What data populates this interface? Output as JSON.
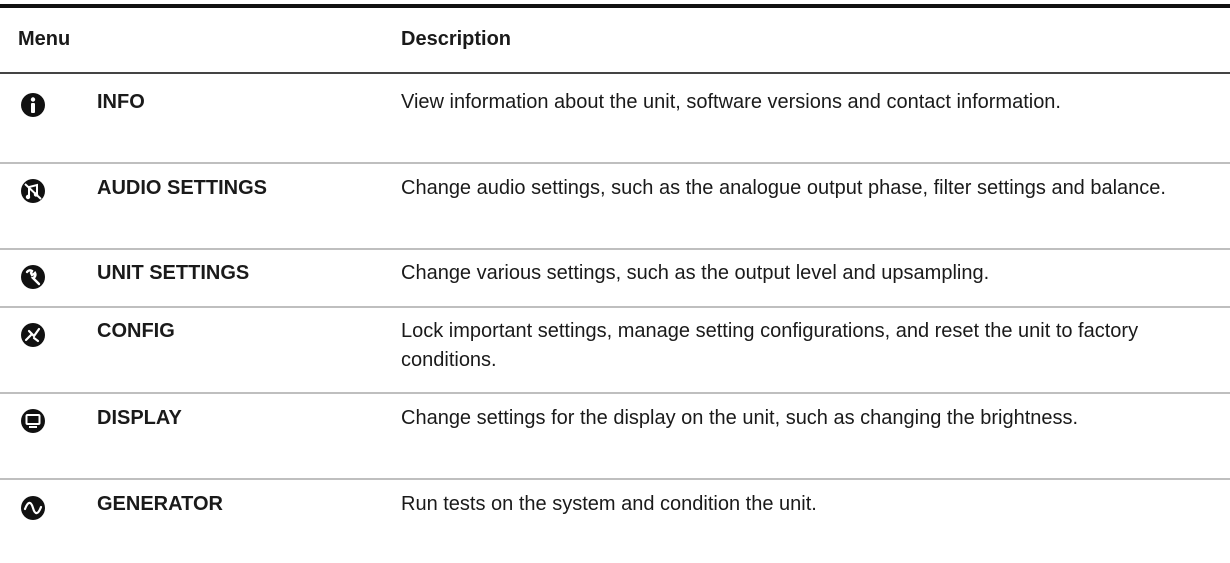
{
  "table": {
    "header": {
      "menu": "Menu",
      "description": "Description"
    },
    "rows": [
      {
        "icon": "info-icon",
        "name": "INFO",
        "description": "View information about the unit, software versions and contact information."
      },
      {
        "icon": "audio-settings-icon",
        "name": "AUDIO SETTINGS",
        "description": "Change audio settings, such as the analogue output phase, filter settings and balance."
      },
      {
        "icon": "wrench-icon",
        "name": "UNIT SETTINGS",
        "description": "Change various settings, such as the output level and upsampling."
      },
      {
        "icon": "config-icon",
        "name": "CONFIG",
        "description": "Lock important settings, manage setting configurations, and reset the unit to factory conditions."
      },
      {
        "icon": "display-icon",
        "name": "DISPLAY",
        "description": "Change settings for the display on the unit, such as changing the brightness."
      },
      {
        "icon": "sine-wave-icon",
        "name": "GENERATOR",
        "description": "Run tests on the system and condition the unit."
      }
    ]
  }
}
